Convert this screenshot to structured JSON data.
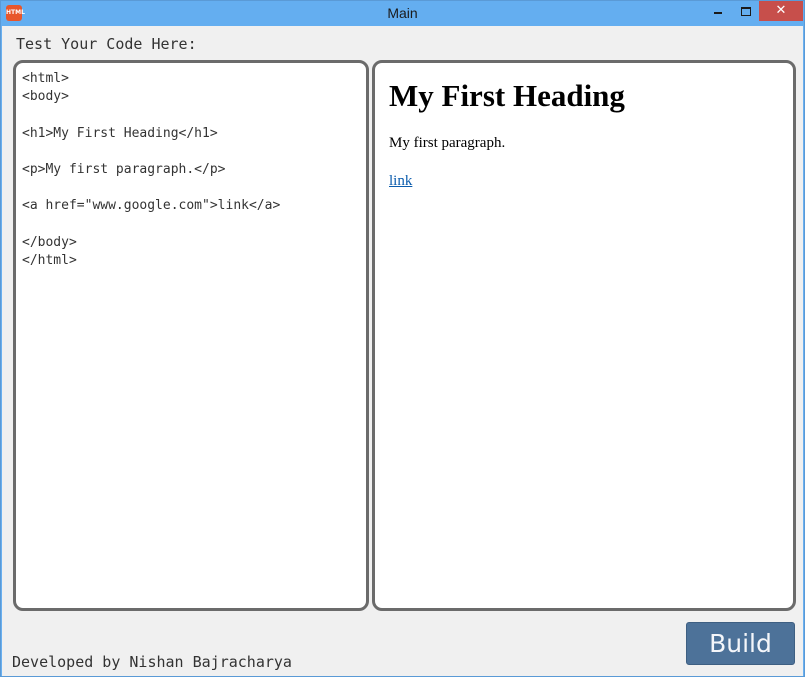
{
  "window": {
    "title": "Main",
    "icon_text": "HTML"
  },
  "controls": {
    "minimize": "minimize-icon",
    "maximize": "maximize-icon",
    "close_glyph": "✕"
  },
  "main": {
    "label": "Test Your Code Here:",
    "editor": {
      "code": "<html>\n<body>\n\n<h1>My First Heading</h1>\n\n<p>My first paragraph.</p>\n\n<a href=\"www.google.com\">link</a>\n\n</body>\n</html>"
    },
    "preview": {
      "heading": "My First Heading",
      "paragraph": "My first paragraph.",
      "link": "link"
    }
  },
  "footer": {
    "credit": "Developed by Nishan Bajracharya",
    "build_label": "Build"
  },
  "colors": {
    "titlebar": "#64aef0",
    "close_button": "#c74f4b",
    "build_button": "#4d7299",
    "panel_border": "#6b6b6b"
  }
}
